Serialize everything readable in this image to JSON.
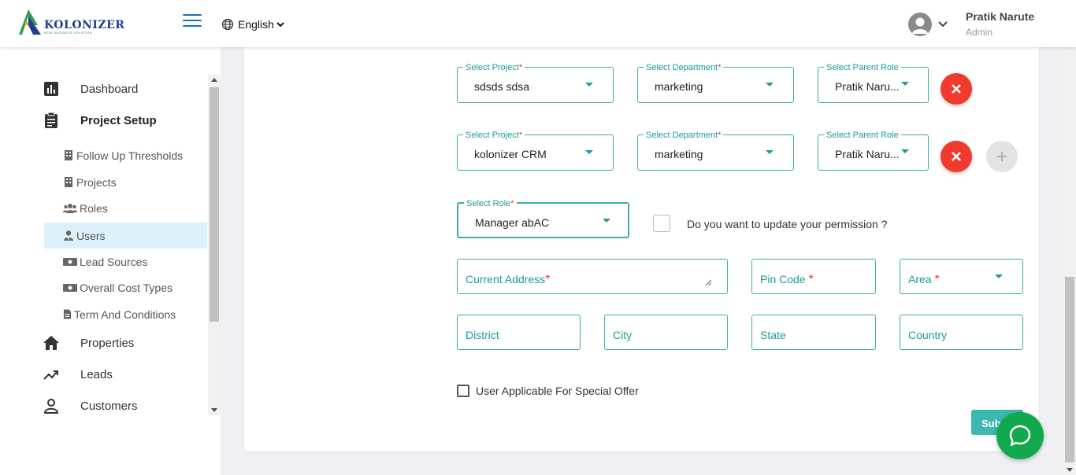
{
  "header": {
    "logo_text": "KOLONIZER",
    "logo_subtitle": "REAL BUSINESS SOLUTION",
    "language": "English",
    "user_name": "Pratik Narute",
    "user_role": "Admin"
  },
  "sidebar": {
    "main_items": [
      {
        "label": "Dashboard",
        "icon": "bar-chart-icon"
      },
      {
        "label": "Project Setup",
        "icon": "clipboard-icon"
      },
      {
        "label": "Properties",
        "icon": "home-icon"
      },
      {
        "label": "Leads",
        "icon": "trending-up-icon"
      },
      {
        "label": "Customers",
        "icon": "person-icon"
      }
    ],
    "sub_items": [
      {
        "label": "Follow Up Thresholds",
        "icon": "building-icon"
      },
      {
        "label": "Projects",
        "icon": "building-icon"
      },
      {
        "label": "Roles",
        "icon": "users-icon"
      },
      {
        "label": "Users",
        "icon": "user-tie-icon",
        "active": true
      },
      {
        "label": "Lead Sources",
        "icon": "money-bill-icon"
      },
      {
        "label": "Overall Cost Types",
        "icon": "money-bill-icon"
      },
      {
        "label": "Term And Conditions",
        "icon": "file-icon"
      }
    ]
  },
  "form": {
    "assignments": [
      {
        "project_label": "Select Project",
        "project": "sdsds sdsa",
        "department_label": "Select Department",
        "department": "marketing",
        "parent_role_label": "Select Parent Role",
        "parent_role": "Pratik Naru..."
      },
      {
        "project_label": "Select Project",
        "project": "kolonizer CRM",
        "department_label": "Select Department",
        "department": "marketing",
        "parent_role_label": "Select Parent Role",
        "parent_role": "Pratik Naru..."
      }
    ],
    "role_label": "Select Role",
    "role_value": "Manager abAC",
    "permission_question": "Do you want to update your permission ?",
    "current_address": "Current Address",
    "pin_code": "Pin Code",
    "area": "Area",
    "district": "District",
    "city": "City",
    "state": "State",
    "country": "Country",
    "special_offer": "User Applicable For Special Offer",
    "submit": "Submit",
    "required_mark": "*"
  },
  "colors": {
    "accent": "#3aafa9",
    "remove": "#f03a2e",
    "active_nav": "#dcf1fc",
    "chat": "#12a84d"
  }
}
